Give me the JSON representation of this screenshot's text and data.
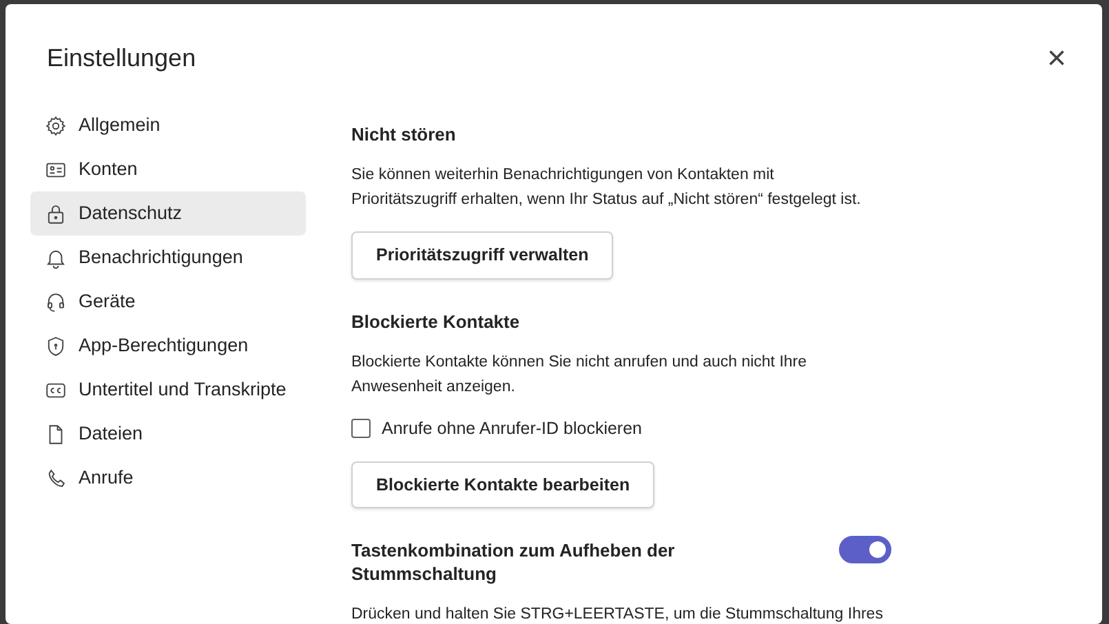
{
  "dialog": {
    "title": "Einstellungen",
    "close": "×"
  },
  "sidebar": {
    "items": [
      {
        "label": "Allgemein",
        "selected": false
      },
      {
        "label": "Konten",
        "selected": false
      },
      {
        "label": "Datenschutz",
        "selected": true
      },
      {
        "label": "Benachrichtigungen",
        "selected": false
      },
      {
        "label": "Geräte",
        "selected": false
      },
      {
        "label": "App-Berechtigungen",
        "selected": false
      },
      {
        "label": "Untertitel und Transkripte",
        "selected": false
      },
      {
        "label": "Dateien",
        "selected": false
      },
      {
        "label": "Anrufe",
        "selected": false
      }
    ]
  },
  "sections": [
    {
      "heading": "Nicht stören",
      "text": "Sie können weiterhin Benachrichtigungen von Kontakten mit Prioritätszugriff erhalten, wenn Ihr Status auf „Nicht stören“ festgelegt ist.",
      "controls": [
        {
          "kind": "button",
          "label": "Prioritätszugriff verwalten"
        }
      ]
    },
    {
      "heading": "Blockierte Kontakte",
      "text": "Blockierte Kontakte können Sie nicht anrufen und auch nicht Ihre Anwesenheit anzeigen.",
      "controls": [
        {
          "kind": "checkbox",
          "label": "Anrufe ohne Anrufer-ID blockieren",
          "checked": false
        },
        {
          "kind": "button",
          "label": "Blockierte Kontakte bearbeiten"
        }
      ]
    },
    {
      "heading": "Tastenkombination zum Aufheben der Stummschaltung",
      "toggle": {
        "on": true
      },
      "text": "Drücken und halten Sie STRG+LEERTASTE, um die Stummschaltung Ihres"
    }
  ]
}
